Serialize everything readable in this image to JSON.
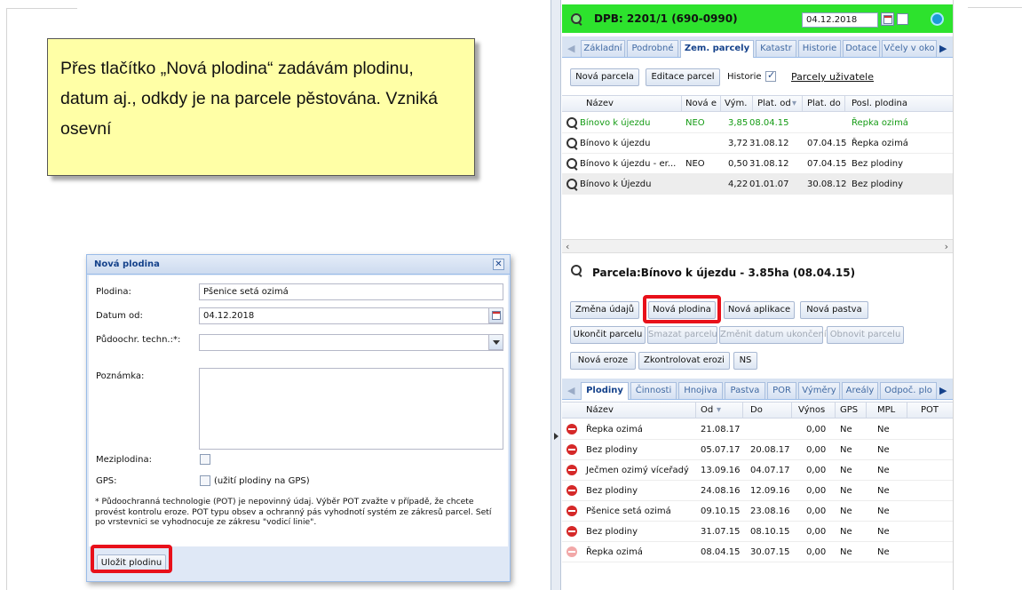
{
  "callout": {
    "text": "Přes tlačítko „Nová plodina“ zadávám plodinu, datum aj., odkdy je na parcele pěstována. Vzniká osevní"
  },
  "dialog": {
    "title": "Nová plodina",
    "close_label": "✕",
    "fields": {
      "plodina_label": "Plodina:",
      "plodina_value": "Pšenice setá ozimá",
      "datum_label": "Datum od:",
      "datum_value": "04.12.2018",
      "pot_label": "Půdoochr. techn.:*:",
      "pot_value": "",
      "poznamka_label": "Poznámka:",
      "poznamka_value": "",
      "meziplodina_label": "Meziplodina:",
      "gps_label": "GPS:",
      "gps_checkbox_text": "(užití plodiny na GPS)"
    },
    "note": "* Půdoochranná technologie (POT) je nepovinný údaj. Výběr POT zvažte v případě, že chcete provést kontrolu eroze. POT typu obsev a ochranný pás vyhodnotí systém ze zákresů parcel. Setí po vrstevnici se vyhodnocuje ze zákresu \"vodicí linie\".",
    "save_button": "Uložit plodinu"
  },
  "app": {
    "header": {
      "title": "DPB: 2201/1 (690-0990)",
      "date": "04.12.2018"
    },
    "top_tabs": [
      "Základní",
      "Podrobné",
      "Zem. parcely",
      "Katastr",
      "Historie",
      "Dotace",
      "Včely v oko"
    ],
    "top_tabs_active": "Zem. parcely",
    "parcel_toolbar": {
      "new_parcel": "Nová parcela",
      "edit_parcels": "Editace parcel",
      "history_label": "Historie",
      "history_checked": true,
      "user_parcels_link": "Parcely uživatele"
    },
    "parcel_grid": {
      "columns": [
        "Název",
        "Nová e",
        "Vým.",
        "Plat. od",
        "Plat. do",
        "Posl. plodina"
      ],
      "rows": [
        {
          "name": "Bínovo k újezdu",
          "nova": "NEO",
          "vym": "3,85",
          "od": "08.04.15",
          "do": "",
          "posl": "Řepka ozimá",
          "highlight": true
        },
        {
          "name": "Bínovo k újezdu",
          "nova": "",
          "vym": "3,72",
          "od": "31.08.12",
          "do": "07.04.15",
          "posl": "Řepka ozimá",
          "highlight": false
        },
        {
          "name": "Bínovo k újezdu - er...",
          "nova": "NEO",
          "vym": "0,50",
          "od": "31.08.12",
          "do": "07.04.15",
          "posl": "Bez plodiny",
          "highlight": false
        },
        {
          "name": "Bínovo k Újezdu",
          "nova": "",
          "vym": "4,22",
          "od": "01.01.07",
          "do": "30.08.12",
          "posl": "Bez plodiny",
          "highlight": false
        }
      ]
    },
    "parcel_title": "Parcela:Bínovo k újezdu - 3.85ha (08.04.15)",
    "actions": {
      "zmena_udaju": "Změna údajů",
      "nova_plodina": "Nová plodina",
      "nova_aplikace": "Nová aplikace",
      "nova_pastva": "Nová pastva",
      "ukoncit_parcelu": "Ukončit parcelu",
      "smazat_parcelu": "Smazat parcelu",
      "zmenit_datum": "Změnit datum ukončení",
      "obnovit_parcelu": "Obnovit parcelu",
      "nova_eroze": "Nová eroze",
      "zkontrolovat_erozi": "Zkontrolovat erozi",
      "ns": "NS"
    },
    "bottom_tabs": [
      "Plodiny",
      "Činnosti",
      "Hnojiva",
      "Pastva",
      "POR",
      "Výměry",
      "Areály",
      "Odpoč. plo"
    ],
    "bottom_tabs_active": "Plodiny",
    "crop_grid": {
      "columns": [
        "Název",
        "Od",
        "Do",
        "Výnos",
        "GPS",
        "MPL",
        "POT"
      ],
      "rows": [
        {
          "name": "Řepka ozimá",
          "od": "21.08.17",
          "do": "",
          "vynos": "0,00",
          "gps": "Ne",
          "mpl": "Ne",
          "faint": false
        },
        {
          "name": "Bez plodiny",
          "od": "05.07.17",
          "do": "20.08.17",
          "vynos": "0,00",
          "gps": "Ne",
          "mpl": "Ne",
          "faint": false
        },
        {
          "name": "Ječmen ozimý víceřadý",
          "od": "13.09.16",
          "do": "04.07.17",
          "vynos": "0,00",
          "gps": "Ne",
          "mpl": "Ne",
          "faint": false
        },
        {
          "name": "Bez plodiny",
          "od": "24.08.16",
          "do": "12.09.16",
          "vynos": "0,00",
          "gps": "Ne",
          "mpl": "Ne",
          "faint": false
        },
        {
          "name": "Pšenice setá ozimá",
          "od": "09.10.15",
          "do": "23.08.16",
          "vynos": "0,00",
          "gps": "Ne",
          "mpl": "Ne",
          "faint": false
        },
        {
          "name": "Bez plodiny",
          "od": "31.07.15",
          "do": "08.10.15",
          "vynos": "0,00",
          "gps": "Ne",
          "mpl": "Ne",
          "faint": false
        },
        {
          "name": "Řepka ozimá",
          "od": "08.04.15",
          "do": "30.07.15",
          "vynos": "0,00",
          "gps": "Ne",
          "mpl": "Ne",
          "faint": true
        }
      ]
    },
    "colors": {
      "header_green": "#2de22d",
      "highlight_red": "#e8101a",
      "row_green": "#149b14"
    }
  }
}
